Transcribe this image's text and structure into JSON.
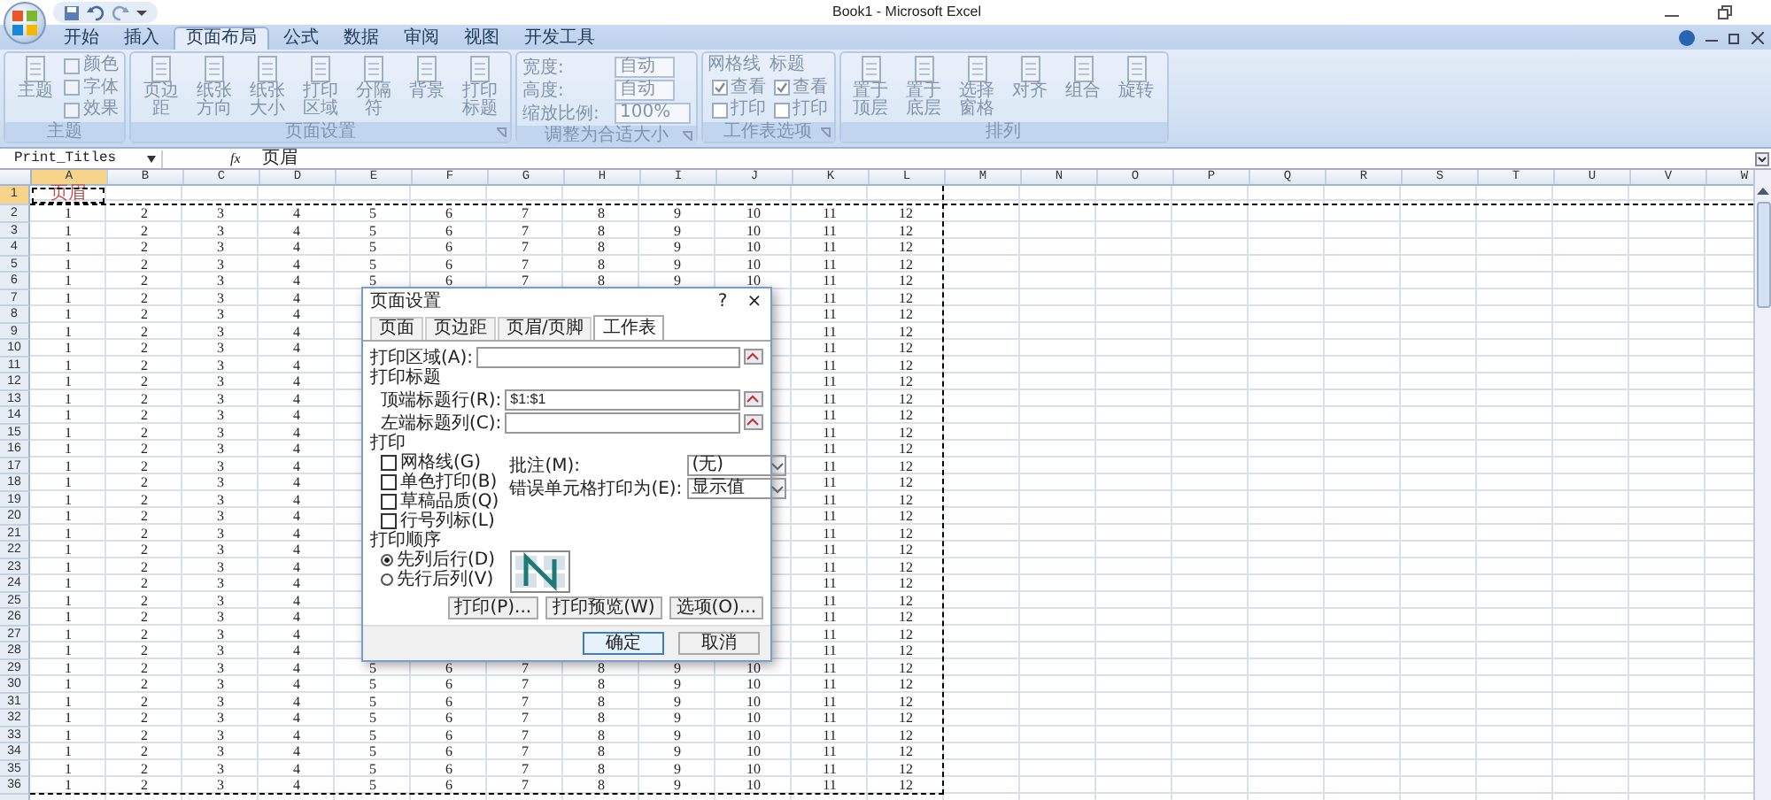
{
  "window": {
    "title": "Book1 - Microsoft Excel"
  },
  "ribbon": {
    "disabled": true,
    "tabs": [
      {
        "label": "开始",
        "selected": false
      },
      {
        "label": "插入",
        "selected": false
      },
      {
        "label": "页面布局",
        "selected": true
      },
      {
        "label": "公式",
        "selected": false
      },
      {
        "label": "数据",
        "selected": false
      },
      {
        "label": "审阅",
        "selected": false
      },
      {
        "label": "视图",
        "selected": false
      },
      {
        "label": "开发工具",
        "selected": false
      }
    ],
    "groups": [
      {
        "label": "主题",
        "launcher": false,
        "items": [
          {
            "kind": "large",
            "label": "主题"
          },
          {
            "kind": "stack",
            "items": [
              {
                "label": "颜色"
              },
              {
                "label": "字体"
              },
              {
                "label": "效果"
              }
            ]
          }
        ]
      },
      {
        "label": "页面设置",
        "launcher": true,
        "items": [
          {
            "kind": "large",
            "label": "页边距"
          },
          {
            "kind": "large",
            "label": "纸张方向"
          },
          {
            "kind": "large",
            "label": "纸张大小"
          },
          {
            "kind": "large",
            "label": "打印区域"
          },
          {
            "kind": "large",
            "label": "分隔符"
          },
          {
            "kind": "large",
            "label": "背景"
          },
          {
            "kind": "large",
            "label": "打印标题"
          }
        ]
      },
      {
        "label": "调整为合适大小",
        "launcher": true,
        "items": [
          {
            "kind": "fields",
            "items": [
              {
                "label": "宽度:",
                "value": "自动"
              },
              {
                "label": "高度:",
                "value": "自动"
              },
              {
                "label": "缩放比例:",
                "value": "100%"
              }
            ]
          }
        ]
      },
      {
        "label": "工作表选项",
        "launcher": true,
        "items": [
          {
            "kind": "checkcol",
            "label": "网格线",
            "options": [
              {
                "label": "查看",
                "checked": true
              },
              {
                "label": "打印",
                "checked": false
              }
            ]
          },
          {
            "kind": "checkcol",
            "label": "标题",
            "options": [
              {
                "label": "查看",
                "checked": true
              },
              {
                "label": "打印",
                "checked": false
              }
            ]
          }
        ]
      },
      {
        "label": "排列",
        "launcher": false,
        "items": [
          {
            "kind": "large",
            "label": "置于顶层"
          },
          {
            "kind": "large",
            "label": "置于底层"
          },
          {
            "kind": "large",
            "label": "选择窗格"
          },
          {
            "kind": "large",
            "label": "对齐"
          },
          {
            "kind": "large",
            "label": "组合"
          },
          {
            "kind": "large",
            "label": "旋转"
          }
        ]
      }
    ]
  },
  "formula_bar": {
    "name_box": "Print_Titles",
    "function_button": "fx",
    "content": "页眉"
  },
  "sheet": {
    "columns": [
      {
        "label": "A",
        "selected": true
      },
      {
        "label": "B",
        "selected": false
      },
      {
        "label": "C",
        "selected": false
      },
      {
        "label": "D",
        "selected": false
      },
      {
        "label": "E",
        "selected": false
      },
      {
        "label": "F",
        "selected": false
      },
      {
        "label": "G",
        "selected": false
      },
      {
        "label": "H",
        "selected": false
      },
      {
        "label": "I",
        "selected": false
      },
      {
        "label": "J",
        "selected": false
      },
      {
        "label": "K",
        "selected": false
      },
      {
        "label": "L",
        "selected": false
      },
      {
        "label": "M",
        "selected": false
      },
      {
        "label": "N",
        "selected": false
      },
      {
        "label": "O",
        "selected": false
      },
      {
        "label": "P",
        "selected": false
      },
      {
        "label": "Q",
        "selected": false
      },
      {
        "label": "R",
        "selected": false
      },
      {
        "label": "S",
        "selected": false
      },
      {
        "label": "T",
        "selected": false
      },
      {
        "label": "U",
        "selected": false
      },
      {
        "label": "V",
        "selected": false
      },
      {
        "label": "W",
        "selected": false
      }
    ],
    "rows": [
      {
        "label": "1",
        "selected": true,
        "cells": [
          "页眉"
        ]
      },
      {
        "label": "2",
        "selected": false,
        "cells": [
          "1",
          "2",
          "3",
          "4",
          "5",
          "6",
          "7",
          "8",
          "9",
          "10",
          "11",
          "12"
        ]
      },
      {
        "label": "3",
        "selected": false,
        "cells": [
          "1",
          "2",
          "3",
          "4",
          "5",
          "6",
          "7",
          "8",
          "9",
          "10",
          "11",
          "12"
        ]
      },
      {
        "label": "4",
        "selected": false,
        "cells": [
          "1",
          "2",
          "3",
          "4",
          "5",
          "6",
          "7",
          "8",
          "9",
          "10",
          "11",
          "12"
        ]
      },
      {
        "label": "5",
        "selected": false,
        "cells": [
          "1",
          "2",
          "3",
          "4",
          "5",
          "6",
          "7",
          "8",
          "9",
          "10",
          "11",
          "12"
        ]
      },
      {
        "label": "6",
        "selected": false,
        "cells": [
          "1",
          "2",
          "3",
          "4",
          "5",
          "6",
          "7",
          "8",
          "9",
          "10",
          "11",
          "12"
        ]
      },
      {
        "label": "7",
        "selected": false,
        "cells": [
          "1",
          "2",
          "3",
          "4",
          null,
          null,
          null,
          null,
          null,
          null,
          "11",
          "12"
        ]
      },
      {
        "label": "8",
        "selected": false,
        "cells": [
          "1",
          "2",
          "3",
          "4",
          null,
          null,
          null,
          null,
          null,
          null,
          "11",
          "12"
        ]
      },
      {
        "label": "9",
        "selected": false,
        "cells": [
          "1",
          "2",
          "3",
          "4",
          null,
          null,
          null,
          null,
          null,
          null,
          "11",
          "12"
        ]
      },
      {
        "label": "10",
        "selected": false,
        "cells": [
          "1",
          "2",
          "3",
          "4",
          null,
          null,
          null,
          null,
          null,
          null,
          "11",
          "12"
        ]
      },
      {
        "label": "11",
        "selected": false,
        "cells": [
          "1",
          "2",
          "3",
          "4",
          null,
          null,
          null,
          null,
          null,
          null,
          "11",
          "12"
        ]
      },
      {
        "label": "12",
        "selected": false,
        "cells": [
          "1",
          "2",
          "3",
          "4",
          null,
          null,
          null,
          null,
          null,
          null,
          "11",
          "12"
        ]
      },
      {
        "label": "13",
        "selected": false,
        "cells": [
          "1",
          "2",
          "3",
          "4",
          null,
          null,
          null,
          null,
          null,
          null,
          "11",
          "12"
        ]
      },
      {
        "label": "14",
        "selected": false,
        "cells": [
          "1",
          "2",
          "3",
          "4",
          null,
          null,
          null,
          null,
          null,
          null,
          "11",
          "12"
        ]
      },
      {
        "label": "15",
        "selected": false,
        "cells": [
          "1",
          "2",
          "3",
          "4",
          null,
          null,
          null,
          null,
          null,
          null,
          "11",
          "12"
        ]
      },
      {
        "label": "16",
        "selected": false,
        "cells": [
          "1",
          "2",
          "3",
          "4",
          null,
          null,
          null,
          null,
          null,
          null,
          "11",
          "12"
        ]
      },
      {
        "label": "17",
        "selected": false,
        "cells": [
          "1",
          "2",
          "3",
          "4",
          null,
          null,
          null,
          null,
          null,
          null,
          "11",
          "12"
        ]
      },
      {
        "label": "18",
        "selected": false,
        "cells": [
          "1",
          "2",
          "3",
          "4",
          null,
          null,
          null,
          null,
          null,
          null,
          "11",
          "12"
        ]
      },
      {
        "label": "19",
        "selected": false,
        "cells": [
          "1",
          "2",
          "3",
          "4",
          null,
          null,
          null,
          null,
          null,
          null,
          "11",
          "12"
        ]
      },
      {
        "label": "20",
        "selected": false,
        "cells": [
          "1",
          "2",
          "3",
          "4",
          null,
          null,
          null,
          null,
          null,
          null,
          "11",
          "12"
        ]
      },
      {
        "label": "21",
        "selected": false,
        "cells": [
          "1",
          "2",
          "3",
          "4",
          null,
          null,
          null,
          null,
          null,
          null,
          "11",
          "12"
        ]
      },
      {
        "label": "22",
        "selected": false,
        "cells": [
          "1",
          "2",
          "3",
          "4",
          null,
          null,
          null,
          null,
          null,
          null,
          "11",
          "12"
        ]
      },
      {
        "label": "23",
        "selected": false,
        "cells": [
          "1",
          "2",
          "3",
          "4",
          null,
          null,
          null,
          null,
          null,
          null,
          "11",
          "12"
        ]
      },
      {
        "label": "24",
        "selected": false,
        "cells": [
          "1",
          "2",
          "3",
          "4",
          null,
          null,
          null,
          null,
          null,
          null,
          "11",
          "12"
        ]
      },
      {
        "label": "25",
        "selected": false,
        "cells": [
          "1",
          "2",
          "3",
          "4",
          null,
          null,
          null,
          null,
          null,
          null,
          "11",
          "12"
        ]
      },
      {
        "label": "26",
        "selected": false,
        "cells": [
          "1",
          "2",
          "3",
          "4",
          null,
          null,
          null,
          null,
          null,
          null,
          "11",
          "12"
        ]
      },
      {
        "label": "27",
        "selected": false,
        "cells": [
          "1",
          "2",
          "3",
          "4",
          null,
          null,
          null,
          null,
          null,
          null,
          "11",
          "12"
        ]
      },
      {
        "label": "28",
        "selected": false,
        "cells": [
          "1",
          "2",
          "3",
          "4",
          null,
          null,
          null,
          null,
          null,
          null,
          "11",
          "12"
        ]
      },
      {
        "label": "29",
        "selected": false,
        "cells": [
          "1",
          "2",
          "3",
          "4",
          "5",
          "6",
          "7",
          "8",
          "9",
          "10",
          "11",
          "12"
        ]
      },
      {
        "label": "30",
        "selected": false,
        "cells": [
          "1",
          "2",
          "3",
          "4",
          "5",
          "6",
          "7",
          "8",
          "9",
          "10",
          "11",
          "12"
        ]
      },
      {
        "label": "31",
        "selected": false,
        "cells": [
          "1",
          "2",
          "3",
          "4",
          "5",
          "6",
          "7",
          "8",
          "9",
          "10",
          "11",
          "12"
        ]
      },
      {
        "label": "32",
        "selected": false,
        "cells": [
          "1",
          "2",
          "3",
          "4",
          "5",
          "6",
          "7",
          "8",
          "9",
          "10",
          "11",
          "12"
        ]
      },
      {
        "label": "33",
        "selected": false,
        "cells": [
          "1",
          "2",
          "3",
          "4",
          "5",
          "6",
          "7",
          "8",
          "9",
          "10",
          "11",
          "12"
        ]
      },
      {
        "label": "34",
        "selected": false,
        "cells": [
          "1",
          "2",
          "3",
          "4",
          "5",
          "6",
          "7",
          "8",
          "9",
          "10",
          "11",
          "12"
        ]
      },
      {
        "label": "35",
        "selected": false,
        "cells": [
          "1",
          "2",
          "3",
          "4",
          "5",
          "6",
          "7",
          "8",
          "9",
          "10",
          "11",
          "12"
        ]
      },
      {
        "label": "36",
        "selected": false,
        "cells": [
          "1",
          "2",
          "3",
          "4",
          "5",
          "6",
          "7",
          "8",
          "9",
          "10",
          "11",
          "12"
        ]
      }
    ]
  },
  "dialog": {
    "title": "页面设置",
    "help": "?",
    "close": "×",
    "tabs": [
      {
        "label": "页面",
        "selected": false
      },
      {
        "label": "页边距",
        "selected": false
      },
      {
        "label": "页眉/页脚",
        "selected": false
      },
      {
        "label": "工作表",
        "selected": true
      }
    ],
    "print_area": {
      "label": "打印区域(A):"
    },
    "print_titles": {
      "label": "打印标题",
      "rows": [
        {
          "label": "顶端标题行(R):",
          "value": "$1:$1"
        },
        {
          "label": "左端标题列(C):"
        }
      ]
    },
    "print": {
      "label": "打印",
      "options": [
        {
          "label": "网格线(G)",
          "checked": false
        },
        {
          "label": "单色打印(B)",
          "checked": false
        },
        {
          "label": "草稿品质(Q)",
          "checked": false
        },
        {
          "label": "行号列标(L)",
          "checked": false
        }
      ],
      "selects": [
        {
          "label": "批注(M):",
          "value": "(无)"
        },
        {
          "label": "错误单元格打印为(E):",
          "value": "显示值"
        }
      ]
    },
    "order": {
      "label": "打印顺序",
      "options": [
        {
          "label": "先列后行(D)",
          "selected": true
        },
        {
          "label": "先行后列(V)",
          "selected": false
        }
      ]
    },
    "buttons": [
      {
        "label": "打印(P)...",
        "kind": "action",
        "default": false
      },
      {
        "label": "打印预览(W)",
        "kind": "action",
        "default": false
      },
      {
        "label": "选项(O)...",
        "kind": "action",
        "default": false
      },
      {
        "label": "确定",
        "kind": "commit",
        "default": true
      },
      {
        "label": "取消",
        "kind": "commit",
        "default": false
      }
    ]
  }
}
